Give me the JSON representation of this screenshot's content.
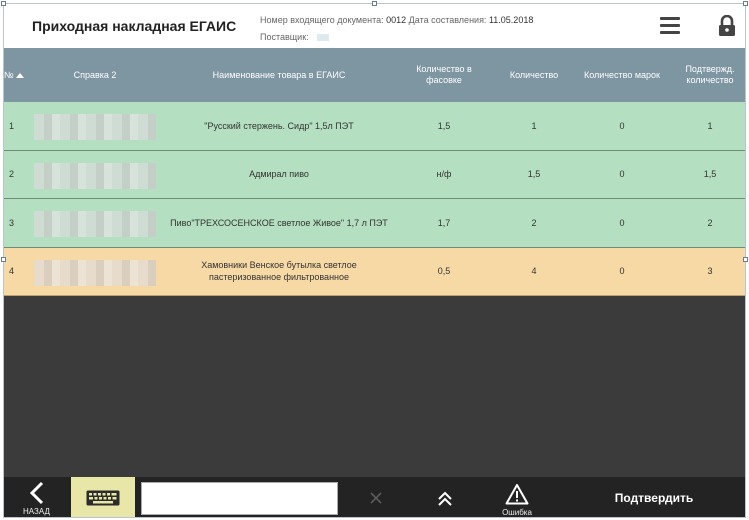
{
  "header": {
    "title": "Приходная накладная ЕГАИС",
    "doc_number_label": "Номер входящего документа:",
    "doc_number": "0012",
    "date_label": "Дата составления:",
    "date": "11.05.2018",
    "supplier_label": "Поставщик:",
    "icons": [
      "menu-icon",
      "lock-icon"
    ]
  },
  "table": {
    "columns": [
      "№",
      "Справка 2",
      "Наименование товара в ЕГАИС",
      "Количество в фасовке",
      "Количество",
      "Количество марок",
      "Подтвержд. количество"
    ],
    "rows": [
      {
        "num": "1",
        "name": "\"Русский стержень. Сидр\" 1,5л ПЭТ",
        "pack_qty": "1,5",
        "qty": "1",
        "marks": "0",
        "confirmed": "1",
        "status": "green"
      },
      {
        "num": "2",
        "name": "Адмирал пиво",
        "pack_qty": "н/ф",
        "qty": "1,5",
        "marks": "0",
        "confirmed": "1,5",
        "status": "green"
      },
      {
        "num": "3",
        "name": "Пиво\"ТРЕХСОСЕНСКОЕ светлое Живое\" 1,7 л ПЭТ",
        "pack_qty": "1,7",
        "qty": "2",
        "marks": "0",
        "confirmed": "2",
        "status": "green"
      },
      {
        "num": "4",
        "name": "Хамовники Венское бутылка светлое пастеризованное фильтрованное",
        "pack_qty": "0,5",
        "qty": "4",
        "marks": "0",
        "confirmed": "3",
        "status": "orange"
      }
    ]
  },
  "toolbar": {
    "back_label": "НАЗАД",
    "input_value": "",
    "error_label": "Ошибка",
    "confirm_label": "Подтвердить"
  },
  "colors": {
    "header_bg": "#7e95a2",
    "row_ok": "#b4dfc1",
    "row_mismatch": "#f6d9a5",
    "empty_bg": "#3b3b3b",
    "toolbar_bg": "#232323",
    "keyboard_btn": "#e8e7a8"
  }
}
